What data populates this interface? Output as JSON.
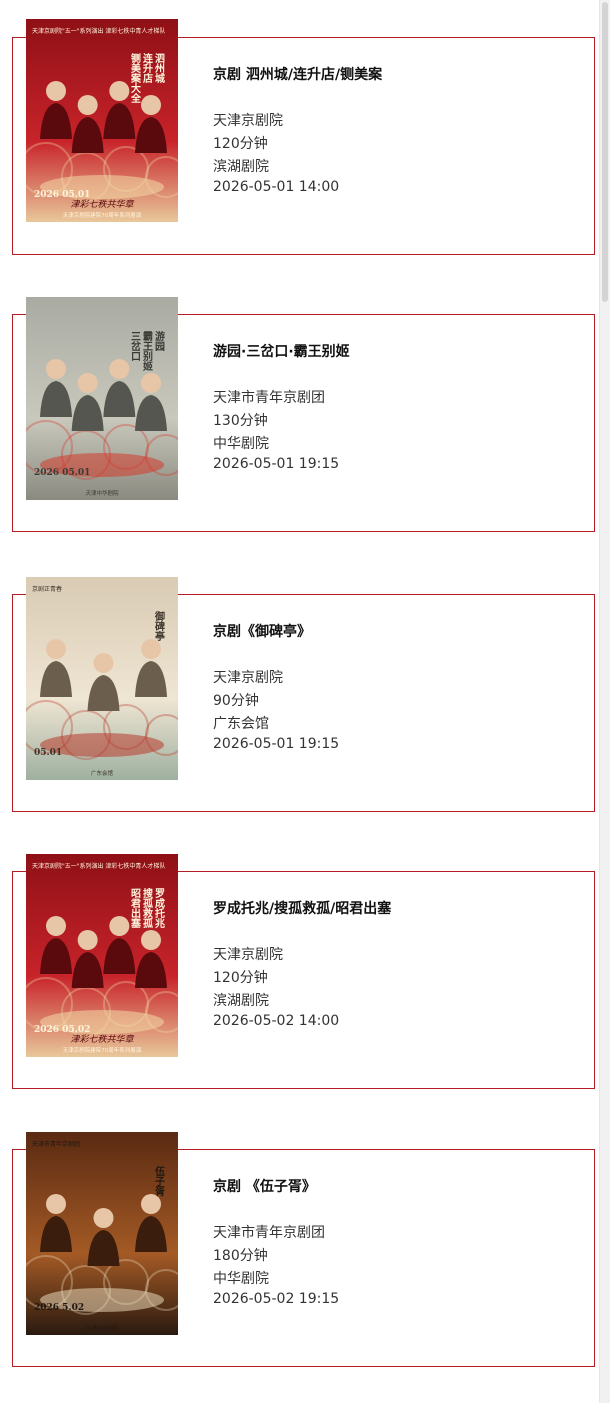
{
  "shows": [
    {
      "title": "京剧 泗州城/连升店/铡美案",
      "troupe": "天津京剧院",
      "duration": "120分钟",
      "venue": "滨湖剧院",
      "datetime": "2026-05-01 14:00",
      "poster": {
        "theme": "red",
        "heading": "天津京剧院\"五一\"系列演出 津彩七秩中青人才梯队展演",
        "play_names": [
          "泗州城",
          "连升店",
          "铡美案大全"
        ],
        "date": "2026 05.01",
        "banner": "津彩七秩共华章",
        "footer": "天津京剧院建院70周年系列展演"
      }
    },
    {
      "title": "游园·三岔口·霸王别姬",
      "troupe": "天津市青年京剧团",
      "duration": "130分钟",
      "venue": "中华剧院",
      "datetime": "2026-05-01 19:15",
      "poster": {
        "theme": "grey",
        "heading": "",
        "play_names": [
          "游园",
          "霸王别姬",
          "三岔口"
        ],
        "date": "2026 05.01",
        "banner": "",
        "footer": "天津中华剧院"
      }
    },
    {
      "title": "京剧《御碑亭》",
      "troupe": "天津京剧院",
      "duration": "90分钟",
      "venue": "广东会馆",
      "datetime": "2026-05-01 19:15",
      "poster": {
        "theme": "beige",
        "heading": "京剧正青春",
        "play_names": [
          "御碑亭"
        ],
        "date": "05.01",
        "banner": "",
        "footer": "广东会馆"
      }
    },
    {
      "title": "罗成托兆/搜孤救孤/昭君出塞",
      "troupe": "天津京剧院",
      "duration": "120分钟",
      "venue": "滨湖剧院",
      "datetime": "2026-05-02 14:00",
      "poster": {
        "theme": "red",
        "heading": "天津京剧院\"五一\"系列演出 津彩七秩中青人才梯队展演",
        "play_names": [
          "罗成托兆",
          "搜孤救孤",
          "昭君出塞"
        ],
        "date": "2026 05.02",
        "banner": "津彩七秩共华章",
        "footer": "天津京剧院建院70周年系列展演"
      }
    },
    {
      "title": "京剧 《伍子胥》",
      "troupe": "天津市青年京剧团",
      "duration": "180分钟",
      "venue": "中华剧院",
      "datetime": "2026-05-02 19:15",
      "poster": {
        "theme": "bronze",
        "heading": "天津市青年京剧团",
        "play_names": [
          "伍子胥"
        ],
        "date": "2026 5.02",
        "banner": "",
        "footer": "天津中华剧院"
      }
    }
  ],
  "colors": {
    "card_border": "#b51c23",
    "title_text": "#111111",
    "body_text": "#333333"
  }
}
